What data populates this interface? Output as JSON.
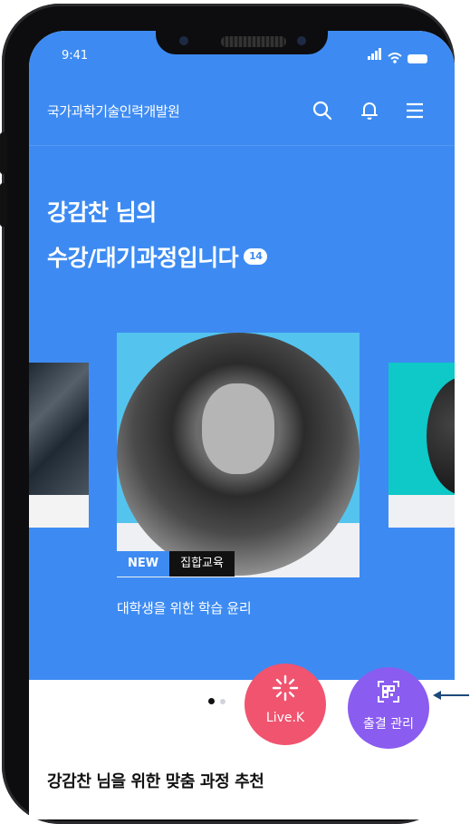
{
  "status_bar": {
    "time": "9:41"
  },
  "header": {
    "org_name": "국가과학기술인력개발원"
  },
  "greeting": {
    "line1": "강감찬 님의",
    "line2": "수강/대기과정입니다",
    "count": "14"
  },
  "featured_course": {
    "badge_new": "NEW",
    "type": "집합교육",
    "title": "대학생을 위한 학습 윤리"
  },
  "carousel": {
    "pages": 2,
    "active": 1
  },
  "fabs": {
    "live_label": "Live.K",
    "attendance_label": "출결 관리"
  },
  "recommend": {
    "title": "강감찬 님을 위한 맞춤 과정 추천"
  },
  "colors": {
    "primary": "#3d8bf2",
    "live": "#f0546f",
    "attendance": "#8a5cf0",
    "new_badge": "#3d8bf2"
  },
  "icons": [
    "search-icon",
    "bell-icon",
    "menu-icon",
    "sparkle-icon",
    "qr-scan-icon"
  ]
}
